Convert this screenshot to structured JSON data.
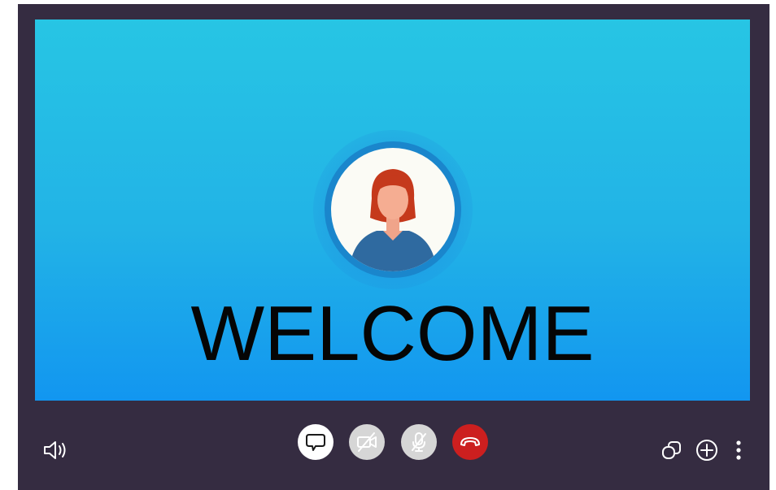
{
  "stage": {
    "welcome_text": "WELCOME",
    "background_colors": [
      "#27c5e4",
      "#1296f0"
    ]
  },
  "avatar": {
    "icon": "user-avatar-icon"
  },
  "controls": {
    "left": [
      {
        "icon": "volume-icon"
      }
    ],
    "center": [
      {
        "icon": "chat-bubble-icon",
        "color": "#ffffff"
      },
      {
        "icon": "video-off-icon",
        "color": "#d6d6d6"
      },
      {
        "icon": "mic-off-icon",
        "color": "#d6d6d6"
      },
      {
        "icon": "end-call-icon",
        "color": "#cc1f1f"
      }
    ],
    "right": [
      {
        "icon": "copy-icon"
      },
      {
        "icon": "add-circle-icon"
      },
      {
        "icon": "more-vertical-icon"
      }
    ]
  },
  "colors": {
    "frame": "#352c41",
    "end_call": "#cc1f1f"
  }
}
